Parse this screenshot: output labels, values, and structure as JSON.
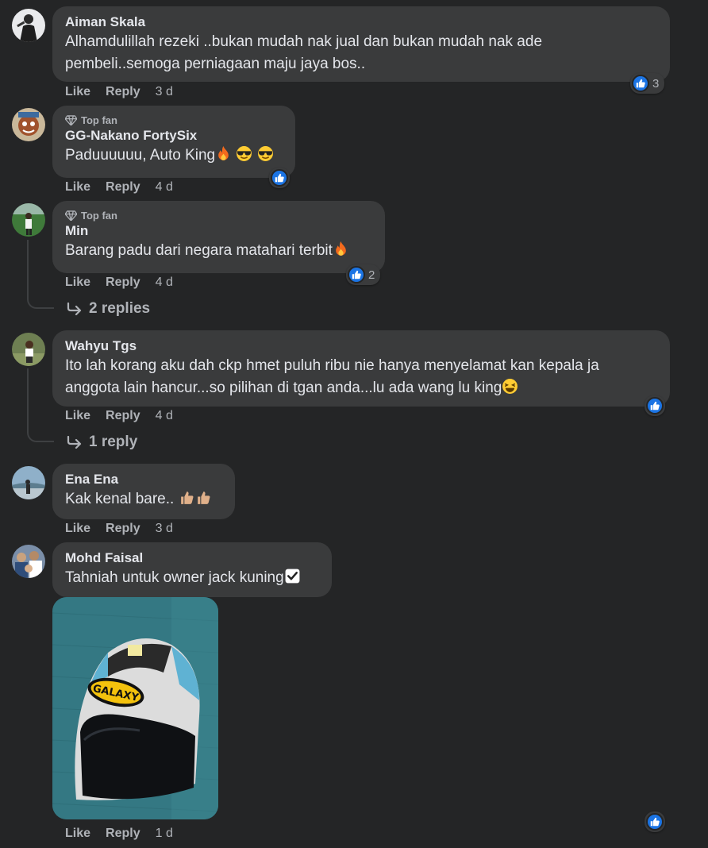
{
  "actions": {
    "like": "Like",
    "reply": "Reply"
  },
  "comments": [
    {
      "author": "Aiman Skala",
      "badge": "",
      "line1": "Alhamdulillah rezeki ..bukan mudah nak jual dan bukan mudah nak ade",
      "line2": "pembeli..semoga perniagaan maju jaya bos..",
      "time": "3 d",
      "reaction_count": "3"
    },
    {
      "author": "GG-Nakano FortySix",
      "badge": "Top fan",
      "line1": "Paduuuuuu, Auto King",
      "time": "4 d",
      "reaction_count": ""
    },
    {
      "author": "Min",
      "badge": "Top fan",
      "line1": "Barang padu dari negara matahari terbit",
      "time": "4 d",
      "reaction_count": "2",
      "replies": "2 replies"
    },
    {
      "author": "Wahyu Tgs",
      "badge": "",
      "line1": "Ito lah korang aku dah ckp hmet puluh ribu nie hanya menyelamat kan kepala ja",
      "line2": "anggota lain hancur...so pilihan di tgan anda...lu ada wang lu king",
      "time": "4 d",
      "reaction_count": "",
      "replies": "1 reply"
    },
    {
      "author": "Ena Ena",
      "badge": "",
      "line1": "Kak kenal bare.. ",
      "time": "3 d",
      "reaction_count": ""
    },
    {
      "author": "Mohd Faisal",
      "badge": "",
      "line1": "Tahniah untuk owner jack kuning",
      "time": "1 d",
      "reaction_count": "",
      "photo_label": "GALAXY"
    }
  ],
  "colors": {
    "background": "#242526",
    "bubble": "#3a3b3c",
    "like_blue": "#1b74e4"
  }
}
